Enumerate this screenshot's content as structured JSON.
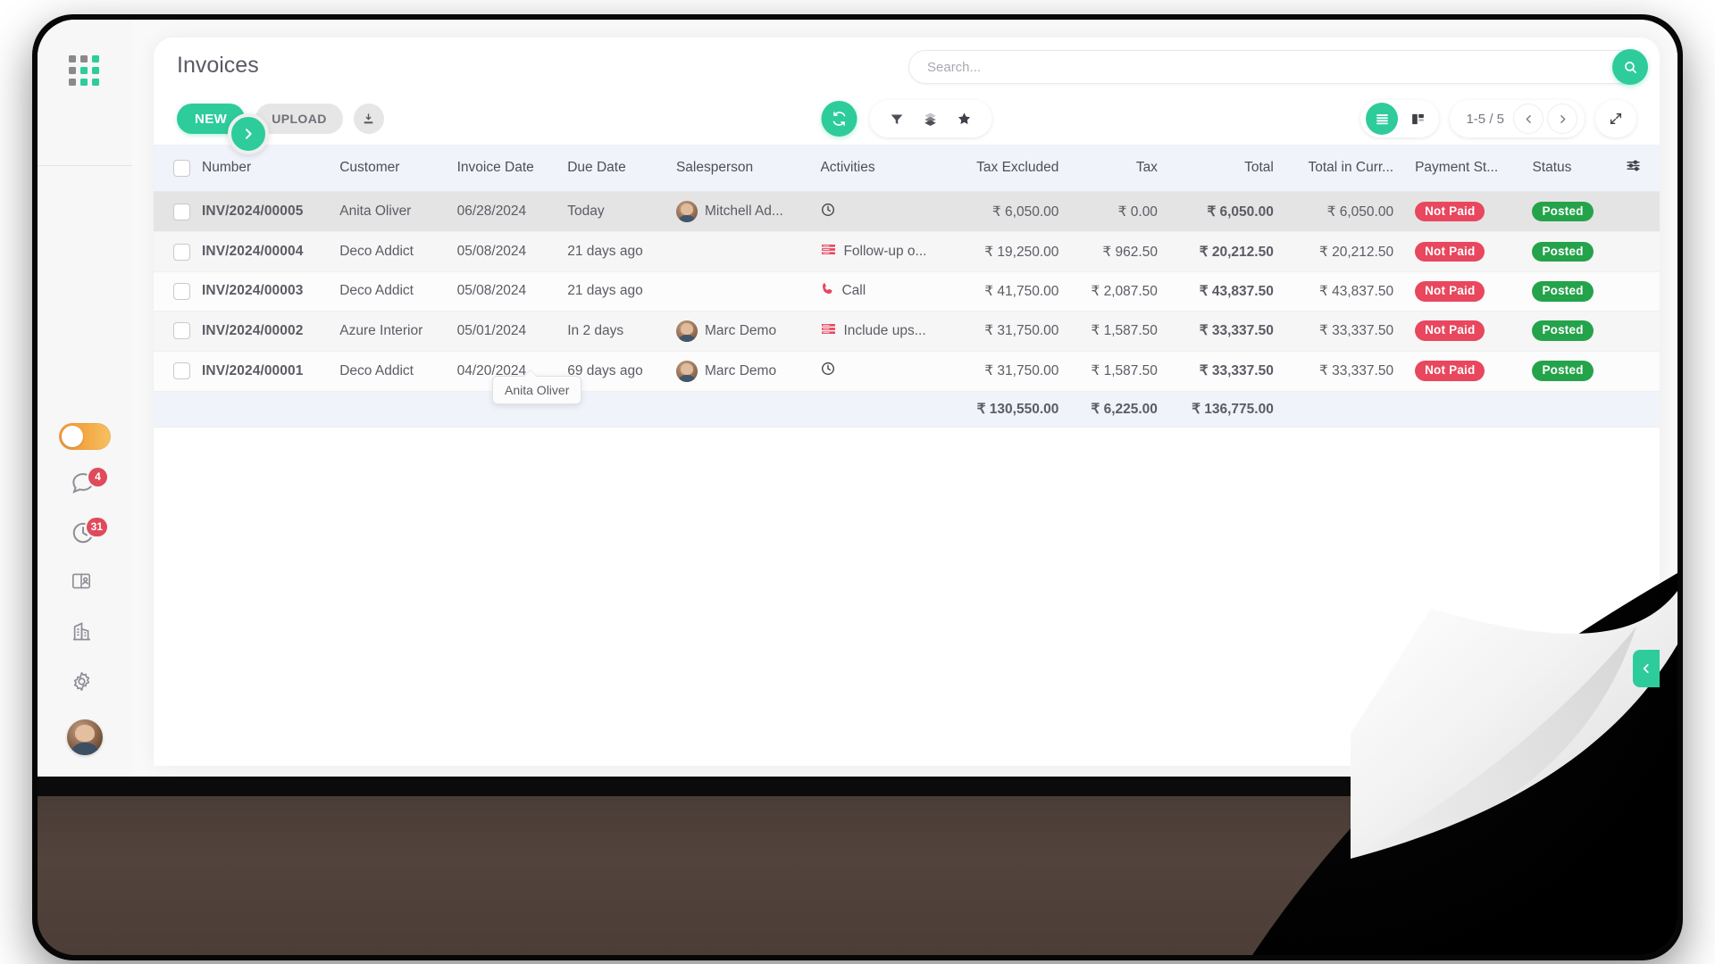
{
  "app": {
    "breadcrumb": "Invoices",
    "apps_icon": "apps-grid-icon"
  },
  "search": {
    "placeholder": "Search...",
    "value": "",
    "button_icon": "search-icon"
  },
  "toolbar": {
    "new_label": "NEW",
    "upload_label": "UPLOAD",
    "download_icon": "download-icon",
    "refresh_icon": "refresh-icon",
    "filter_icon": "filter-icon",
    "group_icon": "group-by-icon",
    "favorite_icon": "star-favorites-icon",
    "list_view_icon": "list-view-icon",
    "kanban_view_icon": "kanban-view-icon",
    "pager_label": "1-5 / 5",
    "prev_icon": "chevron-left-icon",
    "next_icon": "chevron-right-icon",
    "expand_icon": "expand-fullscreen-icon"
  },
  "sidebar": {
    "toggle": "theme-toggle",
    "items": [
      {
        "name": "messages-icon",
        "badge": "4"
      },
      {
        "name": "activities-clock-icon",
        "badge": "31"
      },
      {
        "name": "contacts-card-icon",
        "badge": ""
      },
      {
        "name": "company-building-icon",
        "badge": ""
      },
      {
        "name": "settings-gear-icon",
        "badge": ""
      }
    ],
    "avatar": "user-avatar"
  },
  "table": {
    "columns": [
      {
        "key": "number",
        "label": "Number",
        "align": "left"
      },
      {
        "key": "customer",
        "label": "Customer",
        "align": "left"
      },
      {
        "key": "invoice_date",
        "label": "Invoice Date",
        "align": "left"
      },
      {
        "key": "due_date",
        "label": "Due Date",
        "align": "left"
      },
      {
        "key": "salesperson",
        "label": "Salesperson",
        "align": "left"
      },
      {
        "key": "activities",
        "label": "Activities",
        "align": "left"
      },
      {
        "key": "tax_excluded",
        "label": "Tax Excluded",
        "align": "right"
      },
      {
        "key": "tax",
        "label": "Tax",
        "align": "right"
      },
      {
        "key": "total",
        "label": "Total",
        "align": "right"
      },
      {
        "key": "total_curr",
        "label": "Total in Curr...",
        "align": "right"
      },
      {
        "key": "payment",
        "label": "Payment St...",
        "align": "left"
      },
      {
        "key": "status",
        "label": "Status",
        "align": "left"
      }
    ],
    "options_icon": "column-options-icon",
    "rows": [
      {
        "number": "INV/2024/00005",
        "customer": "Anita Oliver",
        "invoice_date": "06/28/2024",
        "due_date": "Today",
        "due_state": "today",
        "salesperson": "Mitchell Ad...",
        "has_avatar": true,
        "activity": "",
        "activity_icon": "clock-icon",
        "tax_excluded": "₹ 6,050.00",
        "tax": "₹ 0.00",
        "total": "₹ 6,050.00",
        "total_curr": "₹ 6,050.00",
        "payment": "Not Paid",
        "status": "Posted",
        "rowstyle": "row-sel"
      },
      {
        "number": "INV/2024/00004",
        "customer": "Deco Addict",
        "invoice_date": "05/08/2024",
        "due_date": "21 days ago",
        "due_state": "late",
        "salesperson": "",
        "has_avatar": false,
        "activity": "Follow-up o...",
        "activity_icon": "email-list-icon",
        "tax_excluded": "₹ 19,250.00",
        "tax": "₹ 962.50",
        "total": "₹ 20,212.50",
        "total_curr": "₹ 20,212.50",
        "payment": "Not Paid",
        "status": "Posted",
        "rowstyle": "row-alt"
      },
      {
        "number": "INV/2024/00003",
        "customer": "Deco Addict",
        "invoice_date": "05/08/2024",
        "due_date": "21 days ago",
        "due_state": "late",
        "salesperson": "",
        "has_avatar": false,
        "activity": "Call",
        "activity_icon": "phone-icon",
        "tax_excluded": "₹ 41,750.00",
        "tax": "₹ 2,087.50",
        "total": "₹ 43,837.50",
        "total_curr": "₹ 43,837.50",
        "payment": "Not Paid",
        "status": "Posted",
        "rowstyle": "row-plain"
      },
      {
        "number": "INV/2024/00002",
        "customer": "Azure Interior",
        "invoice_date": "05/01/2024",
        "due_date": "In 2 days",
        "due_state": "soon",
        "salesperson": "Marc Demo",
        "has_avatar": true,
        "activity": "Include ups...",
        "activity_icon": "email-list-icon",
        "tax_excluded": "₹ 31,750.00",
        "tax": "₹ 1,587.50",
        "total": "₹ 33,337.50",
        "total_curr": "₹ 33,337.50",
        "payment": "Not Paid",
        "status": "Posted",
        "rowstyle": "row-alt"
      },
      {
        "number": "INV/2024/00001",
        "customer": "Deco Addict",
        "invoice_date": "04/20/2024",
        "due_date": "69 days ago",
        "due_state": "late",
        "salesperson": "Marc Demo",
        "has_avatar": true,
        "activity": "",
        "activity_icon": "clock-icon",
        "tax_excluded": "₹ 31,750.00",
        "tax": "₹ 1,587.50",
        "total": "₹ 33,337.50",
        "total_curr": "₹ 33,337.50",
        "payment": "Not Paid",
        "status": "Posted",
        "rowstyle": "row-plain"
      }
    ],
    "totals": {
      "tax_excluded": "₹ 130,550.00",
      "tax": "₹ 6,225.00",
      "total": "₹ 136,775.00",
      "total_curr": ""
    }
  },
  "tooltip": {
    "text": "Anita Oliver"
  },
  "colors": {
    "accent": "#2ecc9b",
    "danger": "#e8475e",
    "success": "#24a34b",
    "late": "#e8616d",
    "today": "#d9963c",
    "header_bg": "#f0f3f9"
  }
}
